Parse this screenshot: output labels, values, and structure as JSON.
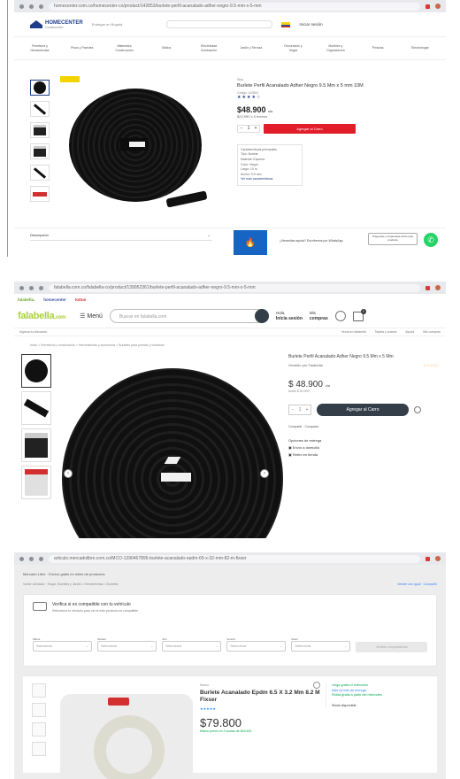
{
  "panel1": {
    "browser": {
      "url": "homecenter.com.co/homecenter-co/product/142853/burlete-perfil-acanalado-adher-negro-9.5-mm-x-5-mm"
    },
    "header": {
      "logo_name": "HOMECENTER",
      "logo_sub": "Construcción",
      "location": "Entregar en Bogotá",
      "user": "Iniciar sesión"
    },
    "categories": [
      "Ferretería y Herramientas",
      "Pisos y Paredes",
      "Materiales Construcción",
      "Baños",
      "Electricidad Iluminación",
      "Jardín y Terraza",
      "Decoración y Hogar",
      "Muebles y Organización",
      "Pinturas",
      "Electrohogar"
    ],
    "product": {
      "badge": "DESTACADO",
      "brand": "Sika",
      "title": "Burlete Perfil Acanalado Adher Negro 9.5 Mm x 5 mm 10M",
      "sku": "Código 142853",
      "stars": "★★★★☆",
      "price": "$48.900",
      "price_unit": "c/u",
      "price_secondary": "$23.950 x 5 metros",
      "qty": "1",
      "add_label": "Agregar al Carro",
      "specs_title": "Características principales",
      "specs": [
        "Tipo: Burlete",
        "Material: Espuma",
        "Color: Negro",
        "Largo: 10 m",
        "Ancho: 9.5 mm"
      ],
      "specs_more": "Ver más características",
      "description_label": "Descripción",
      "ask_text": "¿Necesitas ayuda? Escríbenos por WhatsApp",
      "ask_button": "Preguntas y respuestas sobre este producto"
    }
  },
  "panel2": {
    "browser": {
      "url": "falabella.com.co/falabella-co/product/139952361/burlete-perfil-acanalado-adher-negro-9.5-mm-x-5-mm"
    },
    "pills": {
      "falabella": "falabella.",
      "homecenter": "homecenter",
      "tottus": "tottus"
    },
    "header": {
      "logo": "falabella",
      "logo_suffix": ".com",
      "menu_label": "Menú",
      "search_placeholder": "Buscar en falabella.com",
      "account_top": "Hola,",
      "account_bottom": "Inicia sesión",
      "orders_top": "Mis",
      "orders_bottom": "compras",
      "cart_count": "0"
    },
    "subnav": {
      "left": "Ingresa tu ubicación",
      "links": [
        "Venta en falabella",
        "Tarjeta y cuenta",
        "Ayuda",
        "Mis compras"
      ]
    },
    "breadcrumb": "Inicio > Ferretería y construcción > Herramientas y accesorios > Burletes para puertas y ventanas",
    "product": {
      "title": "Burlete Perfil Acanalado Adher Negro 9.5 Mm x 5 Mm",
      "seller": "Vendido por Falabella",
      "stars": "☆☆☆☆☆",
      "price": "$ 48.900",
      "price_unit": "c/u",
      "price_ref": "Antes $ 54.000",
      "qty": "1",
      "add_label": "Agregar al Carro",
      "links": "Compartir  ·  Comparar",
      "delivery_title": "Opciones de entrega",
      "delivery_1": "Envío a domicilio",
      "delivery_2": "Retiro en tienda"
    }
  },
  "panel3": {
    "browser": {
      "url": "articulo.mercadolibre.com.co/MCO-1390467895-burlete-acanalado-epdm-65-x-32-mm-82-m-fixser"
    },
    "banner": "Mercado Libre · Envíos gratis en miles de productos",
    "crumb": "Volver al listado · Hogar, Muebles y Jardín > Herramientas > Burletes",
    "crumb_right": "Vender uno igual · Compartir",
    "compat": {
      "title": "Verifica si es compatible con tu vehículo",
      "sub": "Selecciona tu vehículo para ver si este producto es compatible",
      "fields": [
        {
          "label": "Marca",
          "placeholder": "Seleccionar"
        },
        {
          "label": "Modelo",
          "placeholder": "Seleccionar"
        },
        {
          "label": "Año",
          "placeholder": "Seleccionar"
        },
        {
          "label": "Versión",
          "placeholder": "Seleccionar"
        },
        {
          "label": "Motor",
          "placeholder": "Seleccionar"
        }
      ],
      "button": "Verificar compatibilidad"
    },
    "product": {
      "status": "Nuevo",
      "name": "Burlete Acanalado Epdm 6.5 X 3.2 Mm 8.2 M Fixser",
      "stars": "★★★★★",
      "price": "$79.800",
      "installments": "Mismo precio en 3 cuotas de $26.600",
      "side_1": "Llega gratis el miércoles",
      "side_2": "Más formas de entrega",
      "side_3": "Retira gratis a partir del miércoles",
      "side_4": "Stock disponible"
    }
  }
}
